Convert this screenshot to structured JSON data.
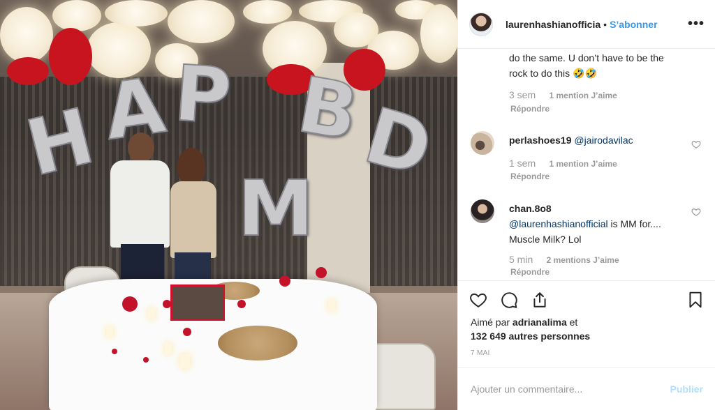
{
  "photo": {
    "alt_icon": "photo"
  },
  "header": {
    "username": "laurenhashianofficia",
    "dot": "•",
    "follow_label": "S’abonner",
    "more_icon": "more-horizontal-icon"
  },
  "comments": [
    {
      "text_tail": "do the same. U don’t have to be the rock to do this 🤣🤣",
      "time": "3 sem",
      "likes": "1 mention J’aime",
      "reply": "Répondre"
    },
    {
      "user": "perlashoes19",
      "mention": "@jairodavilac",
      "text": "",
      "time": "1 sem",
      "likes": "1 mention J’aime",
      "reply": "Répondre"
    },
    {
      "user": "chan.8o8",
      "mention": "@laurenhashianofficial",
      "text": " is MM for.... Muscle Milk? Lol",
      "time": "5 min",
      "likes": "2 mentions J’aime",
      "reply": "Répondre"
    }
  ],
  "likes": {
    "prefix": "Aimé par ",
    "user": "adrianalima",
    "connector": " et",
    "others": "132 649 autres personnes"
  },
  "date": "7 MAI",
  "composer": {
    "placeholder": "Ajouter un commentaire...",
    "post_label": "Publier"
  },
  "colors": {
    "accent": "#3897f0",
    "muted": "#999999",
    "mention": "#003569",
    "post_disabled": "#b2dffc"
  }
}
